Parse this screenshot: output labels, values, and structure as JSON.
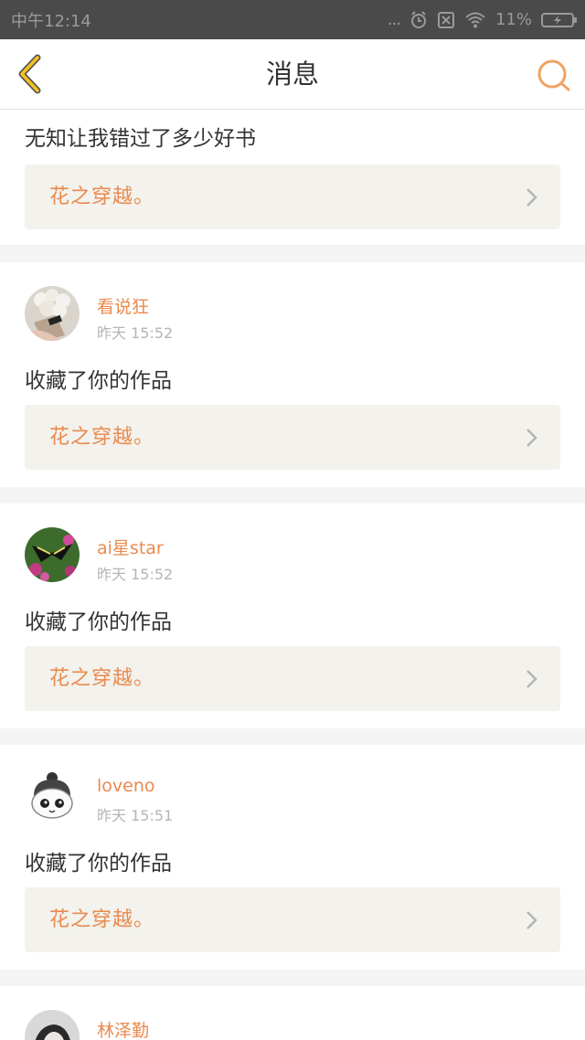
{
  "status_bar": {
    "time": "中午12:14",
    "more": "...",
    "battery": "11%"
  },
  "header": {
    "title": "消息"
  },
  "first_card": {
    "action": "无知让我错过了多少好书",
    "work_title": "花之穿越。"
  },
  "cards": [
    {
      "username": "看说狂",
      "time": "昨天 15:52",
      "action": "收藏了你的作品",
      "work_title": "花之穿越。"
    },
    {
      "username": "ai星star",
      "time": "昨天 15:52",
      "action": "收藏了你的作品",
      "work_title": "花之穿越。"
    },
    {
      "username": "loveno",
      "time": "昨天 15:51",
      "action": "收藏了你的作品",
      "work_title": "花之穿越。"
    },
    {
      "username": "林泽勤"
    }
  ],
  "colors": {
    "accent": "#e98a4f",
    "status_bar": "#4a4a4a",
    "work_bg": "#f3f2ec",
    "back_arrow": "#f3c21c"
  },
  "icons": {
    "back": "chevron-left-icon",
    "search": "search-icon",
    "arrow": "chevron-right-icon"
  }
}
